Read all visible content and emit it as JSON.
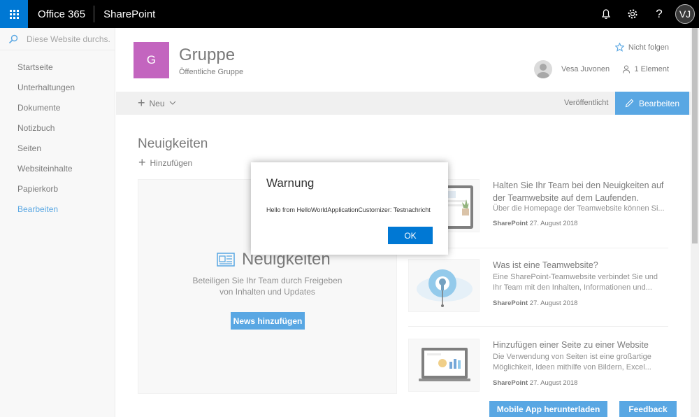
{
  "suitebar": {
    "brand": "Office 365",
    "app": "SharePoint",
    "avatar_initials": "VJ"
  },
  "leftnav": {
    "search_placeholder": "Diese Website durchs...",
    "items": [
      {
        "label": "Startseite"
      },
      {
        "label": "Unterhaltungen"
      },
      {
        "label": "Dokumente"
      },
      {
        "label": "Notizbuch"
      },
      {
        "label": "Seiten"
      },
      {
        "label": "Websiteinhalte"
      },
      {
        "label": "Papierkorb"
      },
      {
        "label": "Bearbeiten"
      }
    ]
  },
  "header": {
    "logo_letter": "G",
    "title": "Gruppe",
    "subtitle": "Öffentliche Gruppe",
    "follow_label": "Nicht folgen",
    "person_name": "Vesa Juvonen",
    "members_label": "1 Element"
  },
  "commandbar": {
    "new_label": "Neu",
    "status": "Veröffentlicht",
    "edit_label": "Bearbeiten"
  },
  "news": {
    "heading": "Neuigkeiten",
    "add_label": "Hinzufügen",
    "placeholder": {
      "title": "Neuigkeiten",
      "text_line1": "Beteiligen Sie Ihr Team durch Freigeben",
      "text_line2": "von Inhalten und Updates",
      "button": "News hinzufügen"
    },
    "articles": [
      {
        "title": "Halten Sie Ihr Team bei den Neuigkeiten auf der Teamwebsite auf dem Laufenden.",
        "desc": "Über die Homepage der Teamwebsite können Si...",
        "source": "SharePoint",
        "date": "27. August 2018"
      },
      {
        "title": "Was ist eine Teamwebsite?",
        "desc": "Eine SharePoint-Teamwebsite verbindet Sie und Ihr Team mit den Inhalten, Informationen und...",
        "source": "SharePoint",
        "date": "27. August 2018"
      },
      {
        "title": "Hinzufügen einer Seite zu einer Website",
        "desc": "Die Verwendung von Seiten ist eine großartige Möglichkeit, Ideen mithilfe von Bildern, Excel...",
        "source": "SharePoint",
        "date": "27. August 2018"
      }
    ]
  },
  "footer_buttons": {
    "mobile_app": "Mobile App herunterladen",
    "feedback": "Feedback"
  },
  "dialog": {
    "title": "Warnung",
    "message": "Hello from HelloWorldApplicationCustomizer: Testnachricht",
    "ok_label": "OK"
  },
  "colors": {
    "accent": "#0078d4",
    "suitebar": "#000000",
    "site_logo": "#a4139d"
  }
}
